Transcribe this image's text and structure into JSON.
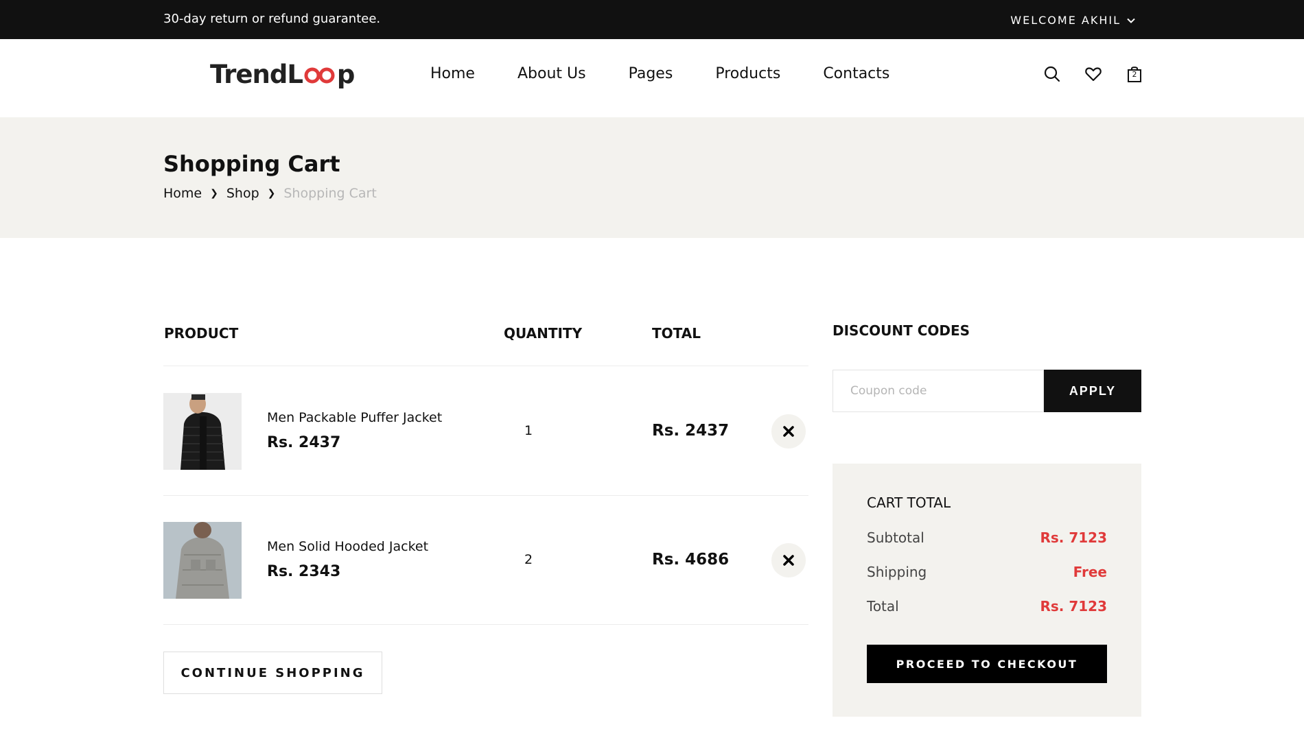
{
  "topbar": {
    "notice": "30-day return or refund guarantee.",
    "welcome": "WELCOME AKHIL"
  },
  "header": {
    "logo": {
      "part1": "Trend",
      "part2": "L",
      "part3": "p"
    },
    "nav": [
      "Home",
      "About Us",
      "Pages",
      "Products",
      "Contacts"
    ],
    "cart_count": "2"
  },
  "banner": {
    "title": "Shopping Cart",
    "breadcrumb": [
      "Home",
      "Shop",
      "Shopping Cart"
    ]
  },
  "cart": {
    "headers": {
      "product": "PRODUCT",
      "quantity": "QUANTITY",
      "total": "TOTAL"
    },
    "items": [
      {
        "name": "Men Packable Puffer Jacket",
        "price": "Rs. 2437",
        "quantity": "1",
        "total": "Rs. 2437"
      },
      {
        "name": "Men Solid Hooded Jacket",
        "price": "Rs. 2343",
        "quantity": "2",
        "total": "Rs. 4686"
      }
    ],
    "continue_label": "CONTINUE SHOPPING"
  },
  "discount": {
    "title": "DISCOUNT CODES",
    "placeholder": "Coupon code",
    "apply_label": "APPLY"
  },
  "cart_total": {
    "title": "CART TOTAL",
    "subtotal_label": "Subtotal",
    "subtotal_value": "Rs. 7123",
    "shipping_label": "Shipping",
    "shipping_value": "Free",
    "total_label": "Total",
    "total_value": "Rs. 7123",
    "checkout_label": "PROCEED TO CHECKOUT"
  },
  "colors": {
    "accent_red": "#e03a3a",
    "dark": "#111111",
    "banner_bg": "#f3f2ee"
  }
}
